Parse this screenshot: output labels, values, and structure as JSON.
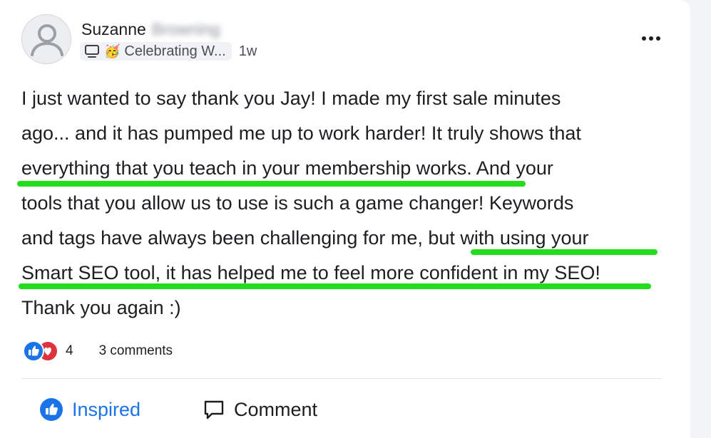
{
  "post": {
    "author_first": "Suzanne",
    "author_last": "Browning",
    "badge_label": "Celebrating W...",
    "badge_emoji": "🥳",
    "time": "1w",
    "lines": [
      "I just wanted to say thank you Jay! I made my first sale minutes",
      "ago... and it has pumped me up to work harder! It truly shows that",
      "everything that you teach in your membership works. And your",
      "tools that you allow us to use is such a game changer! Keywords",
      "and tags have always been challenging for me, but with using your",
      "Smart SEO tool, it has helped me to feel more confident in my SEO!",
      "Thank you again :)"
    ],
    "highlight_color": "#22dd1c"
  },
  "reactions": {
    "count": "4",
    "comments": "3 comments"
  },
  "actions": {
    "inspired": "Inspired",
    "comment": "Comment"
  },
  "colors": {
    "accent": "#1a73e8",
    "love": "#e0323d"
  },
  "icons": [
    "avatar-placeholder-icon",
    "computer-icon",
    "party-emoji-icon",
    "more-options-icon",
    "like-reaction-icon",
    "love-reaction-icon",
    "inspired-thumbs-up-icon",
    "comment-bubble-icon"
  ]
}
